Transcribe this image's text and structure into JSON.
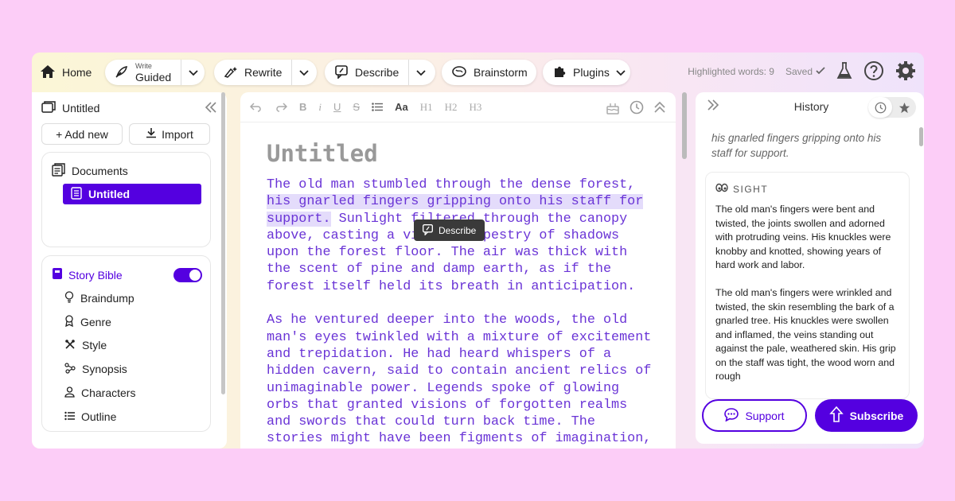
{
  "topbar": {
    "home_label": "Home",
    "write_small": "Write",
    "write_label": "Guided",
    "rewrite_label": "Rewrite",
    "describe_label": "Describe",
    "brainstorm_label": "Brainstorm",
    "plugins_label": "Plugins",
    "highlighted_words": "Highlighted words: 9",
    "saved_label": "Saved"
  },
  "sidebar": {
    "title": "Untitled",
    "add_new": "+ Add new",
    "import": "Import",
    "documents_label": "Documents",
    "selected_doc": "Untitled",
    "story_bible_label": "Story Bible",
    "story_bible_enabled": true,
    "items": [
      "Braindump",
      "Genre",
      "Style",
      "Synopsis",
      "Characters",
      "Outline"
    ]
  },
  "editor": {
    "toolbar": {
      "undo": "↶",
      "redo": "↷",
      "bold": "B",
      "italic": "i",
      "underline": "U",
      "strike": "S",
      "list": "≔",
      "font": "Aa",
      "h1": "H1",
      "h2": "H2",
      "h3": "H3"
    },
    "title": "Untitled",
    "p1_highlighted_before": "The old man stumbled through the dense forest, ",
    "p1_highlight": "his gnarled fingers gripping onto his staff for support.",
    "p1_rest": " Sunlight filtered through the canopy above, casting a vibrant tapestry of shadows upon the forest floor. The air was thick with the scent of pine and damp earth, as if the forest itself held its breath in anticipation.",
    "p2": "As he ventured deeper into the woods, the old man's eyes twinkled with a mixture of excitement and trepidation. He had heard whispers of a hidden cavern, said to contain ancient relics of unimaginable power. Legends spoke of glowing orbs that granted visions of forgotten realms and swords that could turn back time. The stories might have been figments of imagination, but there was an undeniable allure in their promise.",
    "describe_tooltip": "Describe"
  },
  "history": {
    "title": "History",
    "quote": "his gnarled fingers gripping onto his staff for support.",
    "card_label": "SIGHT",
    "card_p1": "The old man's fingers were bent and twisted, the joints swollen and adorned with protruding veins. His knuckles were knobby and knotted, showing years of hard work and labor.",
    "card_p2": "The old man's fingers were wrinkled and twisted, the skin resembling the bark of a gnarled tree. His knuckles were swollen and inflamed, the veins standing out against the pale, weathered skin. His grip on the staff was tight, the wood worn and rough",
    "support_label": "Support",
    "subscribe_label": "Subscribe"
  },
  "colors": {
    "accent": "#5400e0",
    "page_bg": "#fccdf7",
    "text_purple": "#6a34d6"
  }
}
